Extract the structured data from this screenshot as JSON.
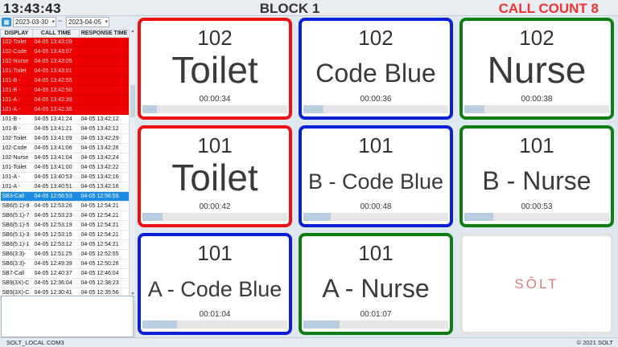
{
  "header": {
    "time": "13:43:43",
    "block": "BLOCK 1",
    "call_count": "CALL COUNT 8",
    "call_count_color": "#e33333"
  },
  "filter": {
    "date_from": "2023-03-30",
    "separator": "~",
    "date_to": "2023-04-05",
    "calendar_icon": "calendar-icon"
  },
  "table": {
    "headers": [
      "DISPLAY",
      "CALL TIME",
      "RESPONSE TIME"
    ],
    "rows": [
      {
        "display": "102-Toilet",
        "call": "04-05 13:43:09",
        "response": "",
        "state": "alarm"
      },
      {
        "display": "102-Code",
        "call": "04-05 13:43:07",
        "response": "",
        "state": "alarm"
      },
      {
        "display": "102-Nurse",
        "call": "04-05 13:43:05",
        "response": "",
        "state": "alarm"
      },
      {
        "display": "101-Toilet",
        "call": "04-05 13:43:01",
        "response": "",
        "state": "alarm"
      },
      {
        "display": "101-B -",
        "call": "04-05 13:42:55",
        "response": "",
        "state": "alarm"
      },
      {
        "display": "101-B -",
        "call": "04-05 13:42:50",
        "response": "",
        "state": "alarm"
      },
      {
        "display": "101-A -",
        "call": "04-05 13:42:39",
        "response": "",
        "state": "alarm"
      },
      {
        "display": "101-A -",
        "call": "04-05 13:42:36",
        "response": "",
        "state": "alarm"
      },
      {
        "display": "101-B -",
        "call": "04-05 13:41:24",
        "response": "04-05 13:42:12",
        "state": "normal"
      },
      {
        "display": "101-B -",
        "call": "04-05 13:41:21",
        "response": "04-05 13:42:12",
        "state": "normal"
      },
      {
        "display": "102-Toilet",
        "call": "04-05 13:41:09",
        "response": "04-05 13:42:29",
        "state": "normal"
      },
      {
        "display": "102-Code",
        "call": "04-05 13:41:06",
        "response": "04-05 13:42:26",
        "state": "normal"
      },
      {
        "display": "102-Nurse",
        "call": "04-05 13:41:04",
        "response": "04-05 13:42:24",
        "state": "normal"
      },
      {
        "display": "101-Toilet",
        "call": "04-05 13:41:00",
        "response": "04-05 13:42:22",
        "state": "normal"
      },
      {
        "display": "101-A -",
        "call": "04-05 13:40:53",
        "response": "04-05 13:42:16",
        "state": "normal"
      },
      {
        "display": "101-A -",
        "call": "04-05 13:40:51",
        "response": "04-05 13:42:16",
        "state": "normal"
      },
      {
        "display": "SB3-Call",
        "call": "04-05 12:56:53",
        "response": "04-05 12:56:55",
        "state": "selected"
      },
      {
        "display": "SB6(5:1)-9",
        "call": "04-05 12:53:26",
        "response": "04-05 12:54:21",
        "state": "normal"
      },
      {
        "display": "SB6(5:1)-7",
        "call": "04-05 12:53:23",
        "response": "04-05 12:54:21",
        "state": "normal"
      },
      {
        "display": "SB6(5:1)-5",
        "call": "04-05 12:53:19",
        "response": "04-05 12:54:21",
        "state": "normal"
      },
      {
        "display": "SB6(5:1)-3",
        "call": "04-05 12:53:15",
        "response": "04-05 12:54:21",
        "state": "normal"
      },
      {
        "display": "SB6(5:1)-1",
        "call": "04-05 12:53:12",
        "response": "04-05 12:54:21",
        "state": "normal"
      },
      {
        "display": "SB6(3:3)-",
        "call": "04-05 12:51:25",
        "response": "04-05 12:52:55",
        "state": "normal"
      },
      {
        "display": "SB6(3:3)-",
        "call": "04-05 12:49:39",
        "response": "04-05 12:50:26",
        "state": "normal"
      },
      {
        "display": "SB7-Call",
        "call": "04-05 12:40:37",
        "response": "04-05 12:46:04",
        "state": "normal"
      },
      {
        "display": "SB9(3X)-C",
        "call": "04-05 12:36:04",
        "response": "04-05 12:38:23",
        "state": "normal"
      },
      {
        "display": "SB9(3X)-C",
        "call": "04-05 12:30:41",
        "response": "04-05 12:35:56",
        "state": "normal"
      }
    ]
  },
  "cards": [
    {
      "room": "102",
      "type": "Toilet",
      "elapsed": "00:00:34",
      "color": "red",
      "size": "big",
      "progress": 0.1
    },
    {
      "room": "102",
      "type": "Code Blue",
      "elapsed": "00:00:36",
      "color": "blue",
      "size": "mid",
      "progress": 0.14
    },
    {
      "room": "102",
      "type": "Nurse",
      "elapsed": "00:00:38",
      "color": "green",
      "size": "big",
      "progress": 0.14
    },
    {
      "room": "101",
      "type": "Toilet",
      "elapsed": "00:00:42",
      "color": "red",
      "size": "big",
      "progress": 0.14
    },
    {
      "room": "101",
      "type": "B - Code Blue",
      "elapsed": "00:00:48",
      "color": "blue",
      "size": "sm",
      "progress": 0.19
    },
    {
      "room": "101",
      "type": "B - Nurse",
      "elapsed": "00:00:53",
      "color": "green",
      "size": "mid",
      "progress": 0.2
    },
    {
      "room": "101",
      "type": "A - Code Blue",
      "elapsed": "00:01:04",
      "color": "blue",
      "size": "sm",
      "progress": 0.24
    },
    {
      "room": "101",
      "type": "A - Nurse",
      "elapsed": "00:01:07",
      "color": "green",
      "size": "mid",
      "progress": 0.25
    }
  ],
  "empty_card": {
    "logo": "SÔLT"
  },
  "status": {
    "station": "SOLT_LOCAL",
    "port": "COM3",
    "copyright": "© 2021 SOLT"
  }
}
